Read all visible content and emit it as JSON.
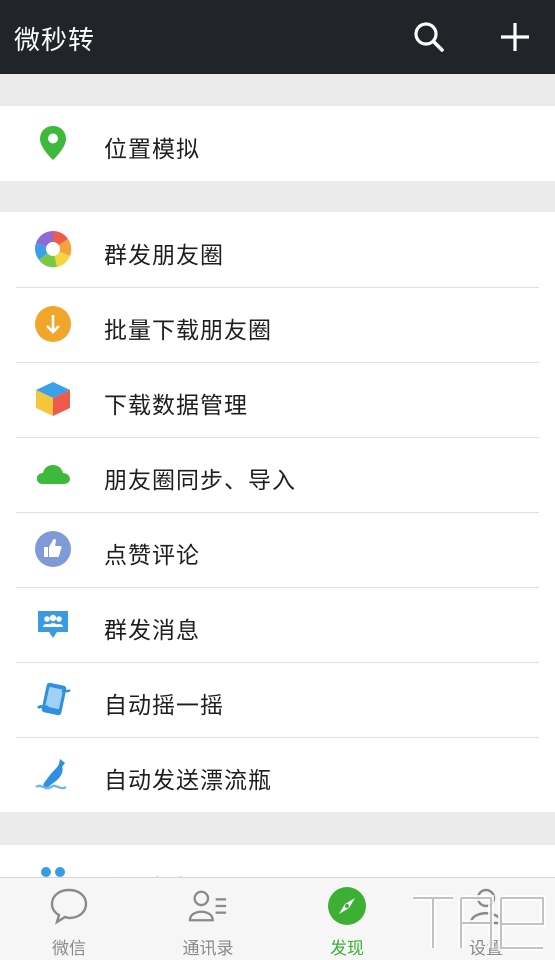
{
  "app_bar": {
    "title": "微秒转",
    "search_icon": "search-icon",
    "add_icon": "plus-icon"
  },
  "groups": [
    {
      "items": [
        {
          "label": "位置模拟",
          "icon": "location-pin-icon",
          "color": "#3fb93c"
        }
      ]
    },
    {
      "items": [
        {
          "label": "群发朋友圈",
          "icon": "aperture-icon",
          "color": "#f2a33a"
        },
        {
          "label": "批量下载朋友圈",
          "icon": "download-circle-icon",
          "color": "#f0a52b"
        },
        {
          "label": "下载数据管理",
          "icon": "cube-icon",
          "color": "#3aa0e8"
        },
        {
          "label": "朋友圈同步、导入",
          "icon": "cloud-icon",
          "color": "#3fb93c"
        },
        {
          "label": "点赞评论",
          "icon": "thumbs-up-icon",
          "color": "#7f9ad6"
        },
        {
          "label": "群发消息",
          "icon": "group-chat-icon",
          "color": "#3a9be0"
        },
        {
          "label": "自动摇一摇",
          "icon": "shake-phone-icon",
          "color": "#2f8fe0"
        },
        {
          "label": "自动发送漂流瓶",
          "icon": "drift-bottle-icon",
          "color": "#2f8fe0"
        }
      ]
    },
    {
      "items": [
        {
          "label": "主动打招呼",
          "icon": "people-icon",
          "color": "#3a9be0"
        }
      ]
    }
  ],
  "tabs": [
    {
      "label": "微信",
      "icon": "chat-bubble-icon",
      "active": false
    },
    {
      "label": "通讯录",
      "icon": "contacts-icon",
      "active": false
    },
    {
      "label": "发现",
      "icon": "compass-icon",
      "active": true
    },
    {
      "label": "设置",
      "icon": "person-icon",
      "active": false
    }
  ],
  "colors": {
    "app_bar": "#212529",
    "active_tab": "#3cb034",
    "inactive_tab": "#8a8a8a",
    "background": "#ebebeb"
  }
}
